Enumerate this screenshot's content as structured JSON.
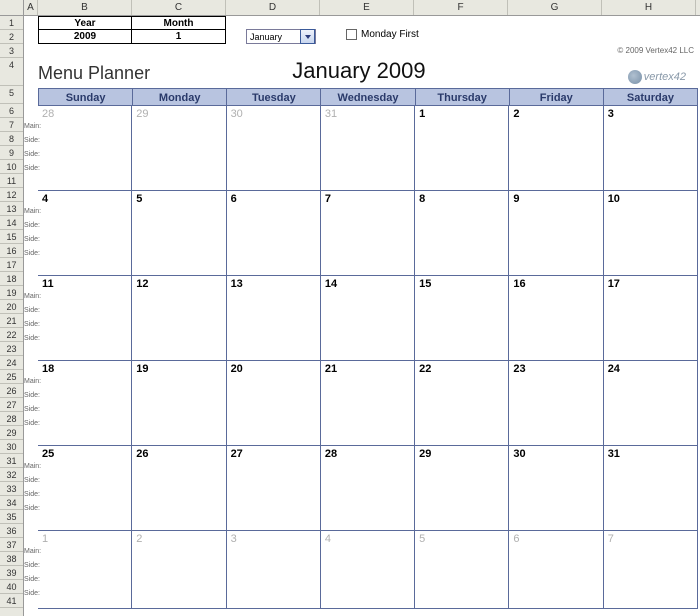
{
  "columns": [
    "A",
    "B",
    "C",
    "D",
    "E",
    "F",
    "G",
    "H"
  ],
  "rows": [
    "1",
    "2",
    "3",
    "4",
    "5",
    "6",
    "7",
    "8",
    "9",
    "10",
    "11",
    "12",
    "13",
    "14",
    "15",
    "16",
    "17",
    "18",
    "19",
    "20",
    "21",
    "22",
    "23",
    "24",
    "25",
    "26",
    "27",
    "28",
    "29",
    "30",
    "31",
    "32",
    "33",
    "34",
    "35",
    "36",
    "37",
    "38",
    "39",
    "40",
    "41"
  ],
  "controls": {
    "year_label": "Year",
    "year_value": "2009",
    "month_label": "Month",
    "month_value": "1",
    "dropdown_value": "January",
    "monday_first_label": "Monday First",
    "monday_first_checked": false
  },
  "copyright": "© 2009 Vertex42 LLC",
  "title": {
    "planner": "Menu Planner",
    "month": "January 2009",
    "brand": "vertex42"
  },
  "day_headers": [
    "Sunday",
    "Monday",
    "Tuesday",
    "Wednesday",
    "Thursday",
    "Friday",
    "Saturday"
  ],
  "side_labels": [
    "Main:",
    "Side:",
    "Side:",
    "Side:"
  ],
  "weeks": [
    [
      {
        "n": "28",
        "faded": true
      },
      {
        "n": "29",
        "faded": true
      },
      {
        "n": "30",
        "faded": true
      },
      {
        "n": "31",
        "faded": true
      },
      {
        "n": "1"
      },
      {
        "n": "2"
      },
      {
        "n": "3"
      }
    ],
    [
      {
        "n": "4"
      },
      {
        "n": "5"
      },
      {
        "n": "6"
      },
      {
        "n": "7"
      },
      {
        "n": "8"
      },
      {
        "n": "9"
      },
      {
        "n": "10"
      }
    ],
    [
      {
        "n": "11"
      },
      {
        "n": "12"
      },
      {
        "n": "13"
      },
      {
        "n": "14"
      },
      {
        "n": "15"
      },
      {
        "n": "16"
      },
      {
        "n": "17"
      }
    ],
    [
      {
        "n": "18"
      },
      {
        "n": "19"
      },
      {
        "n": "20"
      },
      {
        "n": "21"
      },
      {
        "n": "22"
      },
      {
        "n": "23"
      },
      {
        "n": "24"
      }
    ],
    [
      {
        "n": "25"
      },
      {
        "n": "26"
      },
      {
        "n": "27"
      },
      {
        "n": "28"
      },
      {
        "n": "29"
      },
      {
        "n": "30"
      },
      {
        "n": "31"
      }
    ],
    [
      {
        "n": "1",
        "faded": true
      },
      {
        "n": "2",
        "faded": true
      },
      {
        "n": "3",
        "faded": true
      },
      {
        "n": "4",
        "faded": true
      },
      {
        "n": "5",
        "faded": true
      },
      {
        "n": "6",
        "faded": true
      },
      {
        "n": "7",
        "faded": true
      }
    ]
  ]
}
